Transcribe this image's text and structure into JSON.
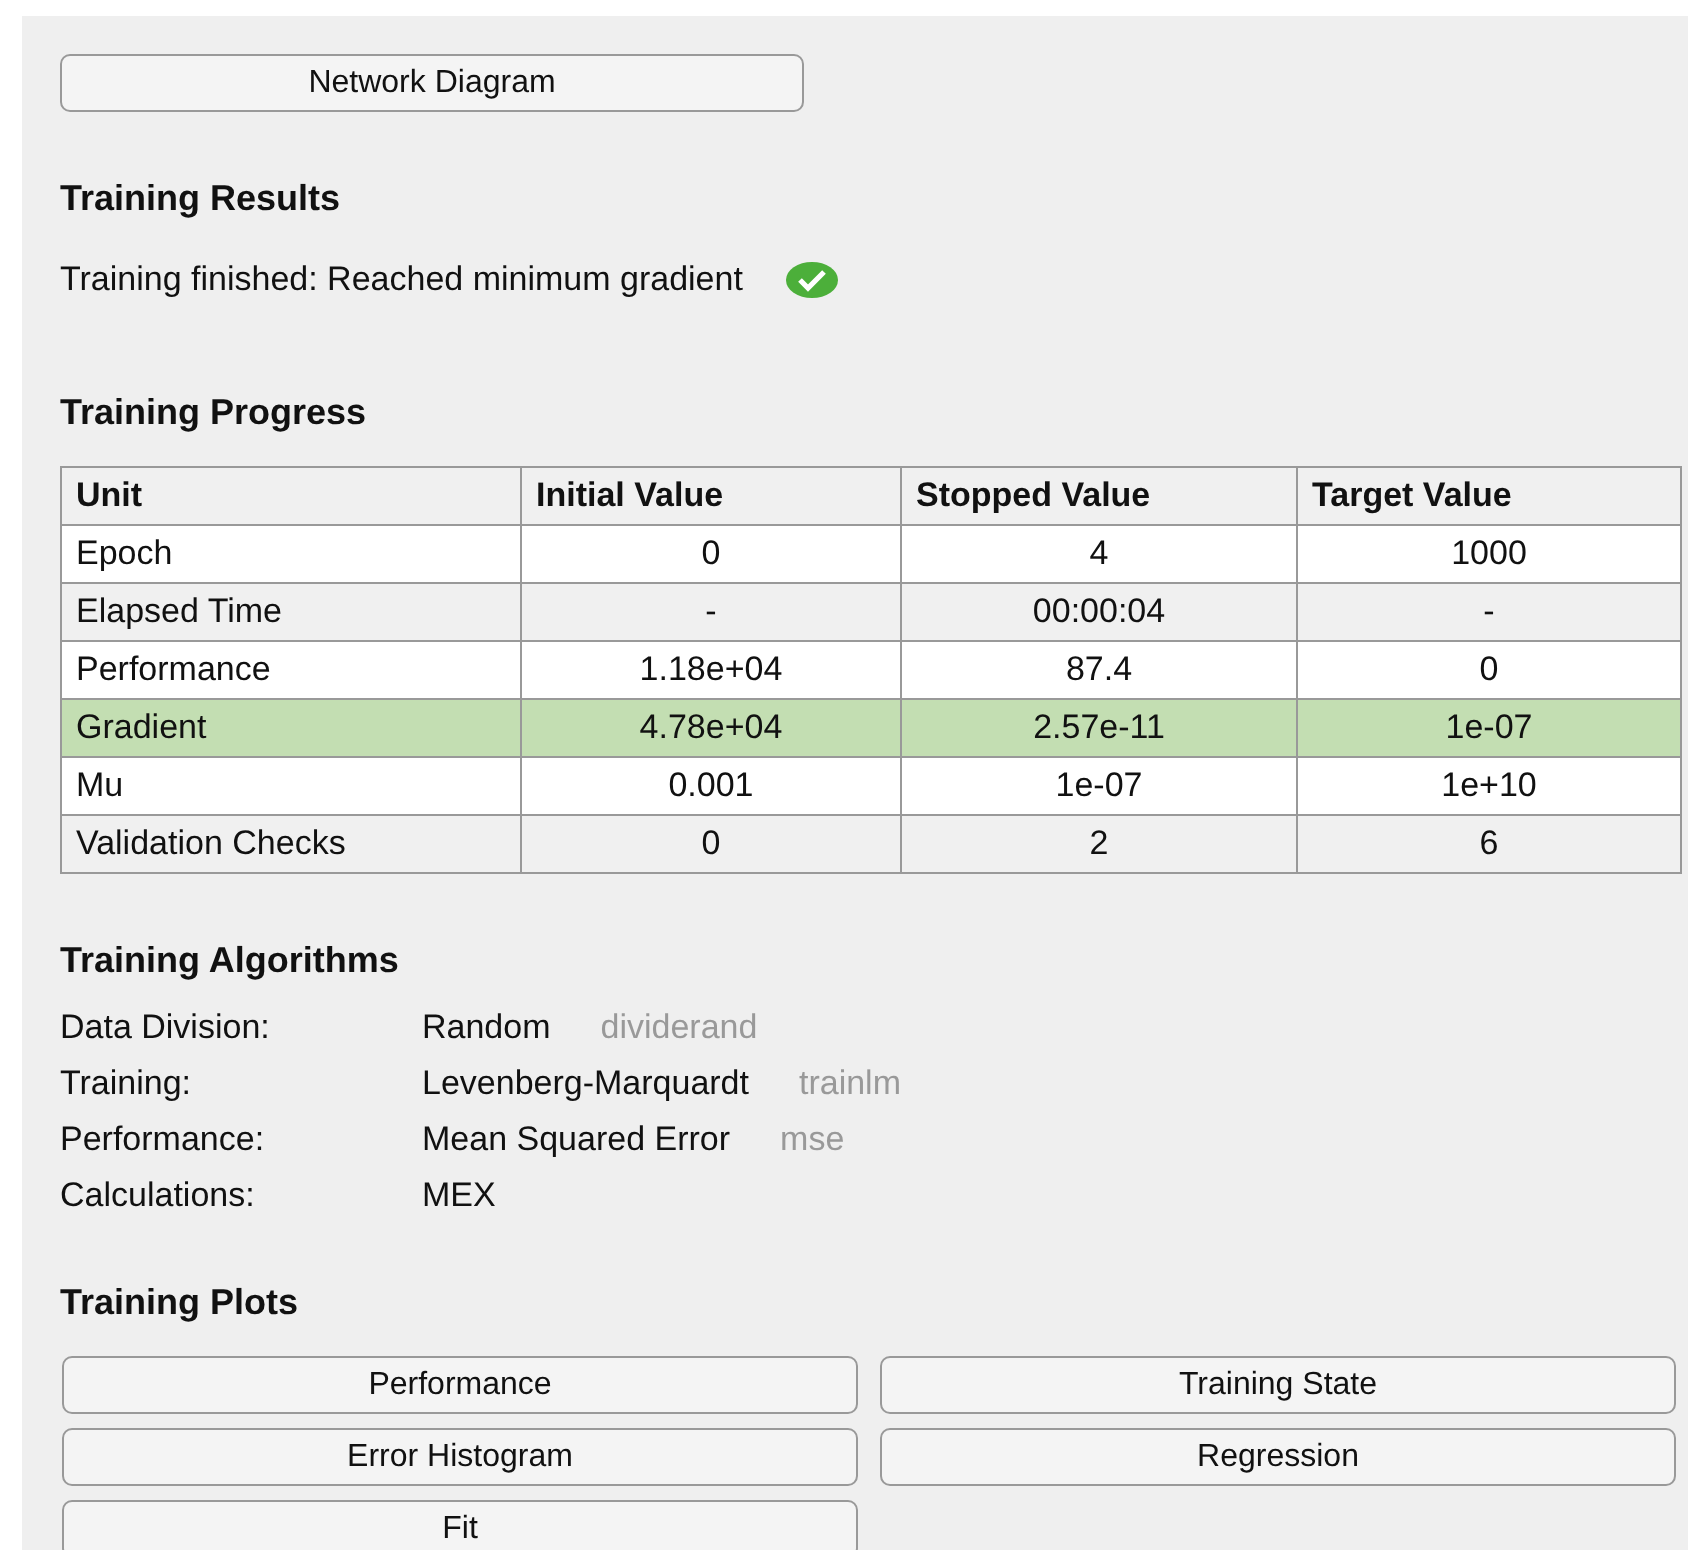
{
  "diagram_button": "Network Diagram",
  "results": {
    "heading": "Training Results",
    "status": "Training finished: Reached minimum gradient",
    "success": true
  },
  "progress": {
    "heading": "Training Progress",
    "columns": [
      "Unit",
      "Initial Value",
      "Stopped Value",
      "Target Value"
    ],
    "rows": [
      {
        "cells": [
          "Epoch",
          "0",
          "4",
          "1000"
        ],
        "highlighted": false
      },
      {
        "cells": [
          "Elapsed Time",
          "-",
          "00:00:04",
          "-"
        ],
        "highlighted": false
      },
      {
        "cells": [
          "Performance",
          "1.18e+04",
          "87.4",
          "0"
        ],
        "highlighted": false
      },
      {
        "cells": [
          "Gradient",
          "4.78e+04",
          "2.57e-11",
          "1e-07"
        ],
        "highlighted": true
      },
      {
        "cells": [
          "Mu",
          "0.001",
          "1e-07",
          "1e+10"
        ],
        "highlighted": false
      },
      {
        "cells": [
          "Validation Checks",
          "0",
          "2",
          "6"
        ],
        "highlighted": false
      }
    ]
  },
  "algorithms": {
    "heading": "Training Algorithms",
    "items": [
      {
        "label": "Data Division:",
        "value": "Random",
        "function": "dividerand"
      },
      {
        "label": "Training:",
        "value": "Levenberg-Marquardt",
        "function": "trainlm"
      },
      {
        "label": "Performance:",
        "value": "Mean Squared Error",
        "function": "mse"
      },
      {
        "label": "Calculations:",
        "value": "MEX"
      }
    ]
  },
  "plots": {
    "heading": "Training Plots",
    "buttons": [
      "Performance",
      "Training State",
      "Error Histogram",
      "Regression",
      "Fit"
    ]
  }
}
